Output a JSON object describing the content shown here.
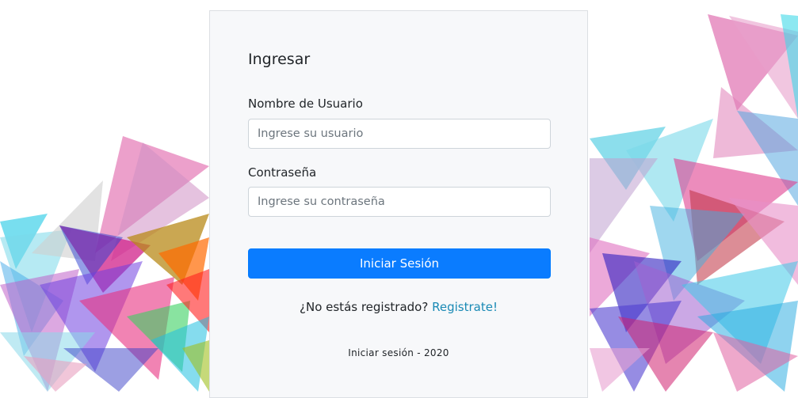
{
  "form": {
    "title": "Ingresar",
    "username_label": "Nombre de Usuario",
    "username_placeholder": "Ingrese su usuario",
    "username_value": "",
    "password_label": "Contraseña",
    "password_placeholder": "Ingrese su contraseña",
    "password_value": "",
    "submit_label": "Iniciar Sesión",
    "register_prompt": "¿No estás registrado?",
    "register_link": "Registrate!",
    "footer": "Iniciar sesión - 2020"
  },
  "colors": {
    "primary_button": "#0a7cff",
    "link": "#1a8ab5",
    "card_background": "#f7f8fa"
  }
}
